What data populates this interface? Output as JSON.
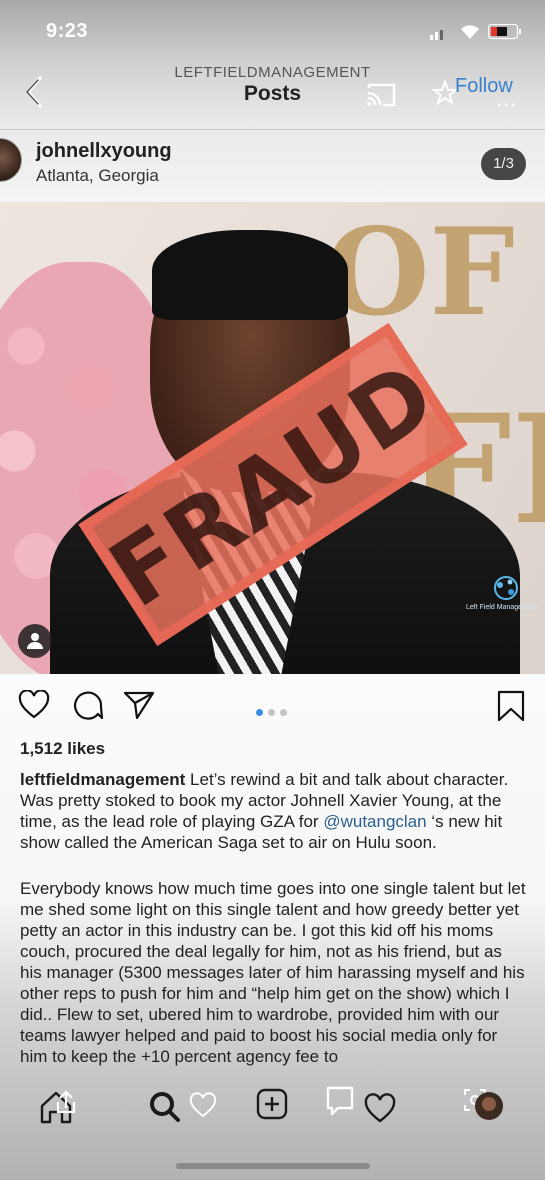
{
  "status_bar": {
    "time": "9:23"
  },
  "nav": {
    "account": "LEFTFIELDMANAGEMENT",
    "title": "Posts",
    "follow_label": "Follow",
    "more_label": "..."
  },
  "post": {
    "username": "johnellxyoung",
    "location": "Atlanta, Georgia",
    "counter": "1/3",
    "stamp_text": "FRAUD",
    "watermark": "Left Field Management",
    "likes": "1,512 likes",
    "caption_user": "leftfieldmanagement",
    "caption_part1": " Let’s rewind a bit and talk about character. Was pretty stoked to book my actor Johnell Xavier Young, at the time, as the lead role of playing GZA for ",
    "caption_mention": "@wutangclan",
    "caption_part2": " ‘s new hit show called the American Saga set to air on Hulu soon.",
    "body": "Everybody knows how much time goes into one single talent but let me shed some light on this single talent and how greedy better yet petty an actor in this industry can be. I got this kid off his moms couch, procured the deal legally for him, not as his friend, but as his manager (5300 messages later of him harassing myself and his other reps to push for him and “help him get on the show) which I did.. Flew to set, ubered him to wardrobe, provided him with our teams lawyer helped and paid to boost his social media only for him to keep the +10 percent agency fee to",
    "carousel": {
      "count": 3,
      "active": 0
    }
  },
  "tabs": [
    "home",
    "search",
    "add",
    "activity",
    "profile"
  ]
}
